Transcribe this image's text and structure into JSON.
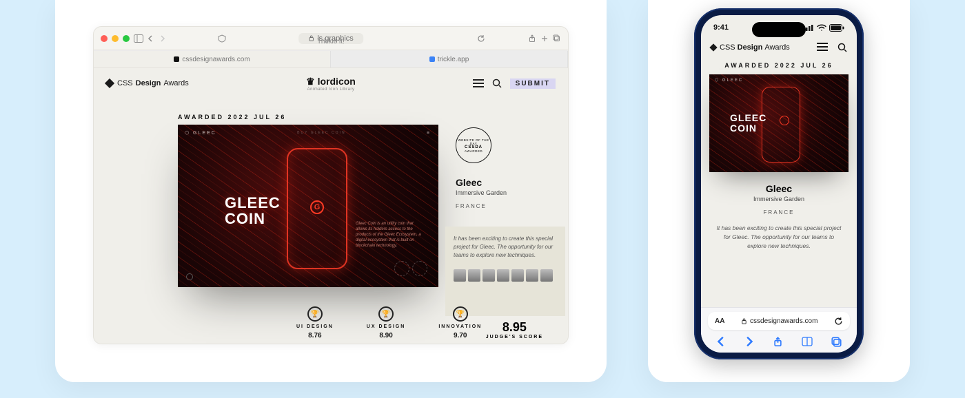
{
  "browser": {
    "address": "ls.graphics",
    "trickle_label": "Trickle it!",
    "tabs": [
      {
        "label": "cssdesignawards.com"
      },
      {
        "label": "trickle.app"
      }
    ]
  },
  "page": {
    "logo_prefix": "CSS",
    "logo_bold": "Design",
    "logo_suffix": "Awards",
    "center_brand": "lordicon",
    "center_brand_sub": "Animated Icon Library",
    "submit": "SUBMIT",
    "award_date": "AWARDED 2022 JUL 26",
    "hero": {
      "brand": "⬡ GLEEC",
      "menu_label": "BUY GLEEC COIN",
      "title_line1": "GLEEC",
      "title_line2": "COIN",
      "blurb": "Gleec Coin is an utility coin that allows its holders access to the products of the Gleec Ecosystem, a digital ecosystem that is built on blockchain technology."
    },
    "wotd_outer": "WEBSITE OF THE DAY",
    "wotd_inner": "CSSDA",
    "wotd_awarded": "AWARDED",
    "project": {
      "title": "Gleec",
      "subtitle": "Immersive Garden",
      "country": "FRANCE"
    },
    "quote": "It has been exciting to create this special project for Gleec. The opportunity for our teams to explore new techniques.",
    "scores": {
      "ui": {
        "label": "UI DESIGN",
        "value": "8.76"
      },
      "ux": {
        "label": "UX DESIGN",
        "value": "8.90"
      },
      "inno": {
        "label": "INNOVATION",
        "value": "9.70"
      },
      "judge": {
        "label": "JUDGE'S SCORE",
        "value": "8.95"
      }
    }
  },
  "mobile": {
    "time": "9:41",
    "award_date": "AWARDED 2022 JUL 26",
    "project": {
      "title": "Gleec",
      "subtitle": "Immersive Garden",
      "country": "FRANCE"
    },
    "quote": "It has been exciting to create this special project for Gleec. The opportunity for our teams to explore new techniques.",
    "url": "cssdesignawards.com",
    "aa": "AA"
  }
}
